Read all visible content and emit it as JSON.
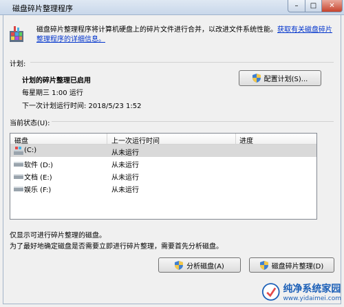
{
  "window": {
    "title": "磁盘碎片整理程序",
    "controls": {
      "minimize": "–",
      "maximize": "□",
      "close": "✕"
    }
  },
  "intro": {
    "text": "磁盘碎片整理程序将计算机硬盘上的碎片文件进行合并，以改进文件系统性能。",
    "link": "获取有关磁盘碎片整理程序的详细信息。"
  },
  "schedule": {
    "label": "计划:",
    "status": "计划的碎片整理已启用",
    "frequency": "每星期三 1:00 运行",
    "next_run": "下一次计划运行时间: 2018/5/23 1:52",
    "configure_button": "配置计划(S)..."
  },
  "current_status": {
    "label": "当前状态(U):",
    "columns": [
      "磁盘",
      "上一次运行时间",
      "进度"
    ],
    "rows": [
      {
        "disk": "(C:)",
        "last_run": "从未运行",
        "progress": ""
      },
      {
        "disk": "软件 (D:)",
        "last_run": "从未运行",
        "progress": ""
      },
      {
        "disk": "文档 (E:)",
        "last_run": "从未运行",
        "progress": ""
      },
      {
        "disk": "娱乐 (F:)",
        "last_run": "从未运行",
        "progress": ""
      }
    ]
  },
  "footer": {
    "note1": "仅显示可进行碎片整理的磁盘。",
    "note2": "为了最好地确定磁盘是否需要立即进行碎片整理，需要首先分析磁盘。",
    "analyze_button": "分析磁盘(A)",
    "defrag_button": "磁盘碎片整理(D)"
  },
  "watermark": {
    "title": "纯净系统家园",
    "url": "www.yidaimei.com"
  },
  "colors": {
    "link": "#0033cc",
    "close": "#c7432c",
    "titlebar": "#c8d7ea"
  }
}
